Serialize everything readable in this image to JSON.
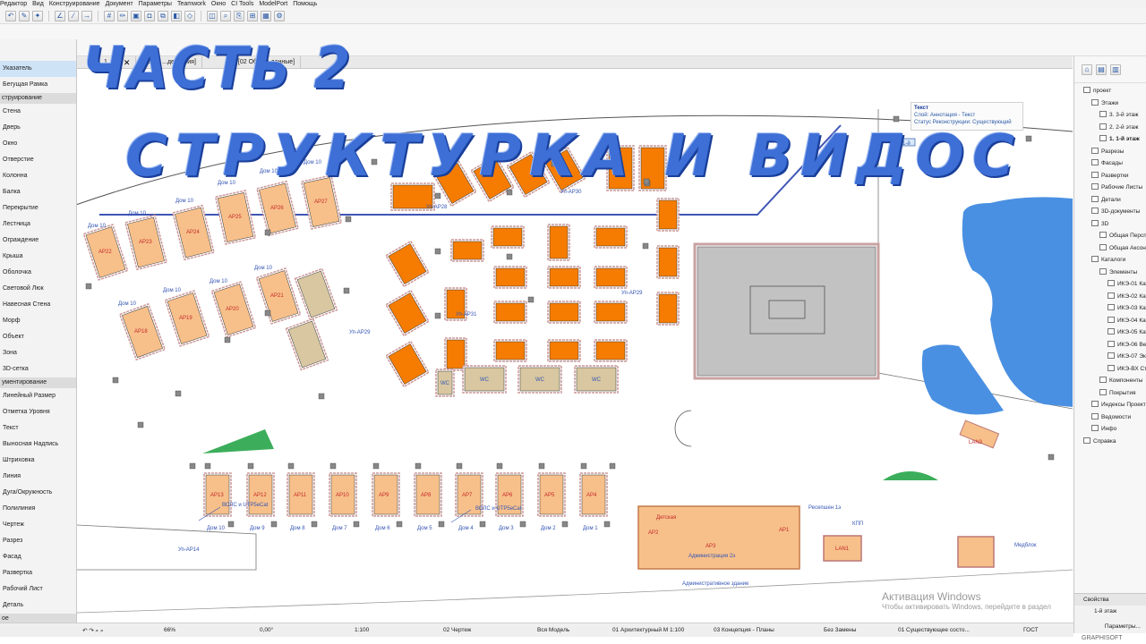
{
  "menu": [
    "Редактор",
    "Вид",
    "Конструирование",
    "Документ",
    "Параметры",
    "Teamwork",
    "Окно",
    "CI Tools",
    "ModelPort",
    "Помощь"
  ],
  "toolbox": {
    "items": [
      {
        "label": "Указатель",
        "type": "tool",
        "selected": true
      },
      {
        "label": "Бегущая Рамка",
        "type": "tool"
      },
      {
        "label": "струирование",
        "type": "section"
      },
      {
        "label": "Стена",
        "type": "tool"
      },
      {
        "label": "Дверь",
        "type": "tool"
      },
      {
        "label": "Окно",
        "type": "tool"
      },
      {
        "label": "Отверстие",
        "type": "tool"
      },
      {
        "label": "Колонна",
        "type": "tool"
      },
      {
        "label": "Балка",
        "type": "tool"
      },
      {
        "label": "Перекрытие",
        "type": "tool"
      },
      {
        "label": "Лестница",
        "type": "tool"
      },
      {
        "label": "Ограждение",
        "type": "tool"
      },
      {
        "label": "Крыша",
        "type": "tool"
      },
      {
        "label": "Оболочка",
        "type": "tool"
      },
      {
        "label": "Световой Люк",
        "type": "tool"
      },
      {
        "label": "Навесная Стена",
        "type": "tool"
      },
      {
        "label": "Морф",
        "type": "tool"
      },
      {
        "label": "Объект",
        "type": "tool"
      },
      {
        "label": "Зона",
        "type": "tool"
      },
      {
        "label": "3D-сетка",
        "type": "tool"
      },
      {
        "label": "ументирование",
        "type": "section"
      },
      {
        "label": "Линейный Размер",
        "type": "tool"
      },
      {
        "label": "Отметка Уровня",
        "type": "tool"
      },
      {
        "label": "Текст",
        "type": "tool"
      },
      {
        "label": "Выносная Надпись",
        "type": "tool"
      },
      {
        "label": "Штриховка",
        "type": "tool"
      },
      {
        "label": "Линия",
        "type": "tool"
      },
      {
        "label": "Дуга/Окружность",
        "type": "tool"
      },
      {
        "label": "Полилиния",
        "type": "tool"
      },
      {
        "label": "Чертеж",
        "type": "tool"
      },
      {
        "label": "Разрез",
        "type": "tool"
      },
      {
        "label": "Фасад",
        "type": "tool"
      },
      {
        "label": "Развертка",
        "type": "tool"
      },
      {
        "label": "Рабочий Лист",
        "type": "tool"
      },
      {
        "label": "Деталь",
        "type": "tool"
      },
      {
        "label": "ое",
        "type": "section"
      }
    ]
  },
  "tabs": [
    {
      "label": "1. 1-й",
      "close": "✕"
    },
    {
      "label": "[Цел... ...действия]"
    },
    {
      "label": "[02 Общие данные]"
    }
  ],
  "overlay": {
    "title1": "ЧАСТЬ 2",
    "title2": "СТРУКТУРКА И ВИДОС"
  },
  "tooltip": {
    "title": "Текст",
    "line1": "Слой: Аннотация - Текст",
    "line2": "Статус Реконструкции: Существующий"
  },
  "plan": {
    "dom_top": [
      "Дом 10",
      "Дом 10",
      "Дом 10",
      "Дом 10",
      "Дом 10",
      "Дом 10"
    ],
    "ap_top": [
      "АР22",
      "АР23",
      "АР24",
      "АР25",
      "АР26",
      "АР27"
    ],
    "dom_mid": [
      "Дом 10",
      "Дом 10",
      "Дом 10",
      "Дом 10"
    ],
    "ap_mid": [
      "АР18",
      "АР19",
      "АР20",
      "АР21"
    ],
    "wc": [
      "WC",
      "WC",
      "WC",
      "WC"
    ],
    "unap": [
      "Уп-АР28",
      "Уп-АР30",
      "Уп-АР31",
      "Уп-АР29",
      "Уп-АР29"
    ],
    "bottom_ap": [
      "АР13",
      "АР12",
      "АР11",
      "АР10",
      "АР9",
      "АР8",
      "АР7",
      "АР6",
      "АР5",
      "АР4"
    ],
    "bottom_dom": [
      "Дом 10",
      "Дом 9",
      "Дом 8",
      "Дом 7",
      "Дом 6",
      "Дом 5",
      "Дом 4",
      "Дом 3",
      "Дом 2",
      "Дом 1"
    ],
    "cable1": "ВОЛС и UTP5eCat",
    "cable2": "ВОЛС и UTP5eCat",
    "un14": "Уп-АР14",
    "ap2": "АР2",
    "ap1": "АР1",
    "ap3": "АР3",
    "detskaya": "Детская",
    "admin": "Администрация 2э",
    "admin_bldg": "Административное здание",
    "reception": "Ресепшен 1э",
    "kpp": "КПП",
    "lan1": "LAN1",
    "lan3": "LAN3",
    "medblok": "Медблок",
    "nav_sel": "1.1-й"
  },
  "navigator": {
    "items": [
      {
        "label": "проект",
        "level": 0
      },
      {
        "label": "Этажи",
        "level": 1
      },
      {
        "label": "3. 3-й этаж",
        "level": 2
      },
      {
        "label": "2. 2-й этаж",
        "level": 2
      },
      {
        "label": "1. 1-й этаж",
        "level": 2,
        "active": true
      },
      {
        "label": "Разрезы",
        "level": 1
      },
      {
        "label": "Фасады",
        "level": 1
      },
      {
        "label": "Развертки",
        "level": 1
      },
      {
        "label": "Рабочие Листы",
        "level": 1
      },
      {
        "label": "Детали",
        "level": 1
      },
      {
        "label": "3D-документы",
        "level": 1
      },
      {
        "label": "3D",
        "level": 1
      },
      {
        "label": "Общая Персп",
        "level": 2
      },
      {
        "label": "Общая Аксон",
        "level": 2
      },
      {
        "label": "Каталоги",
        "level": 1
      },
      {
        "label": "Элементы",
        "level": 2
      },
      {
        "label": "ИКЭ-01 Ката",
        "level": 3
      },
      {
        "label": "ИКЭ-02 Ката",
        "level": 3
      },
      {
        "label": "ИКЭ-03 Ката",
        "level": 3
      },
      {
        "label": "ИКЭ-04 Ката",
        "level": 3
      },
      {
        "label": "ИКЭ-05 Ката",
        "level": 3
      },
      {
        "label": "ИКЭ-06 Ведо",
        "level": 3
      },
      {
        "label": "ИКЭ-07 Эксп",
        "level": 3
      },
      {
        "label": "ИКЭ-ВХ Ста",
        "level": 3
      },
      {
        "label": "Компоненты",
        "level": 2
      },
      {
        "label": "Покрытия",
        "level": 2
      },
      {
        "label": "Индексы Проект",
        "level": 1
      },
      {
        "label": "Ведомости",
        "level": 1
      },
      {
        "label": "Инфо",
        "level": 1
      },
      {
        "label": "Справка",
        "level": 0
      }
    ]
  },
  "properties": {
    "header": "Свойства",
    "value": "1-й этаж",
    "button": "Параметры..."
  },
  "status": {
    "zoom": "66%",
    "angle": "0,00°",
    "scale": "1:100",
    "layer": "02 Чертеж",
    "model": "Вся Модель",
    "arch": "01 Архитектурный М 1:100",
    "concept": "03 Концепция - Планы",
    "changes": "Без Замены",
    "existing": "01 Существующее состо...",
    "standard": "ГОСТ"
  },
  "watermark": {
    "line1": "Активация Windows",
    "line2": "Чтобы активировать Windows, перейдите в раздел"
  },
  "brand": "GRAPHISOFT"
}
